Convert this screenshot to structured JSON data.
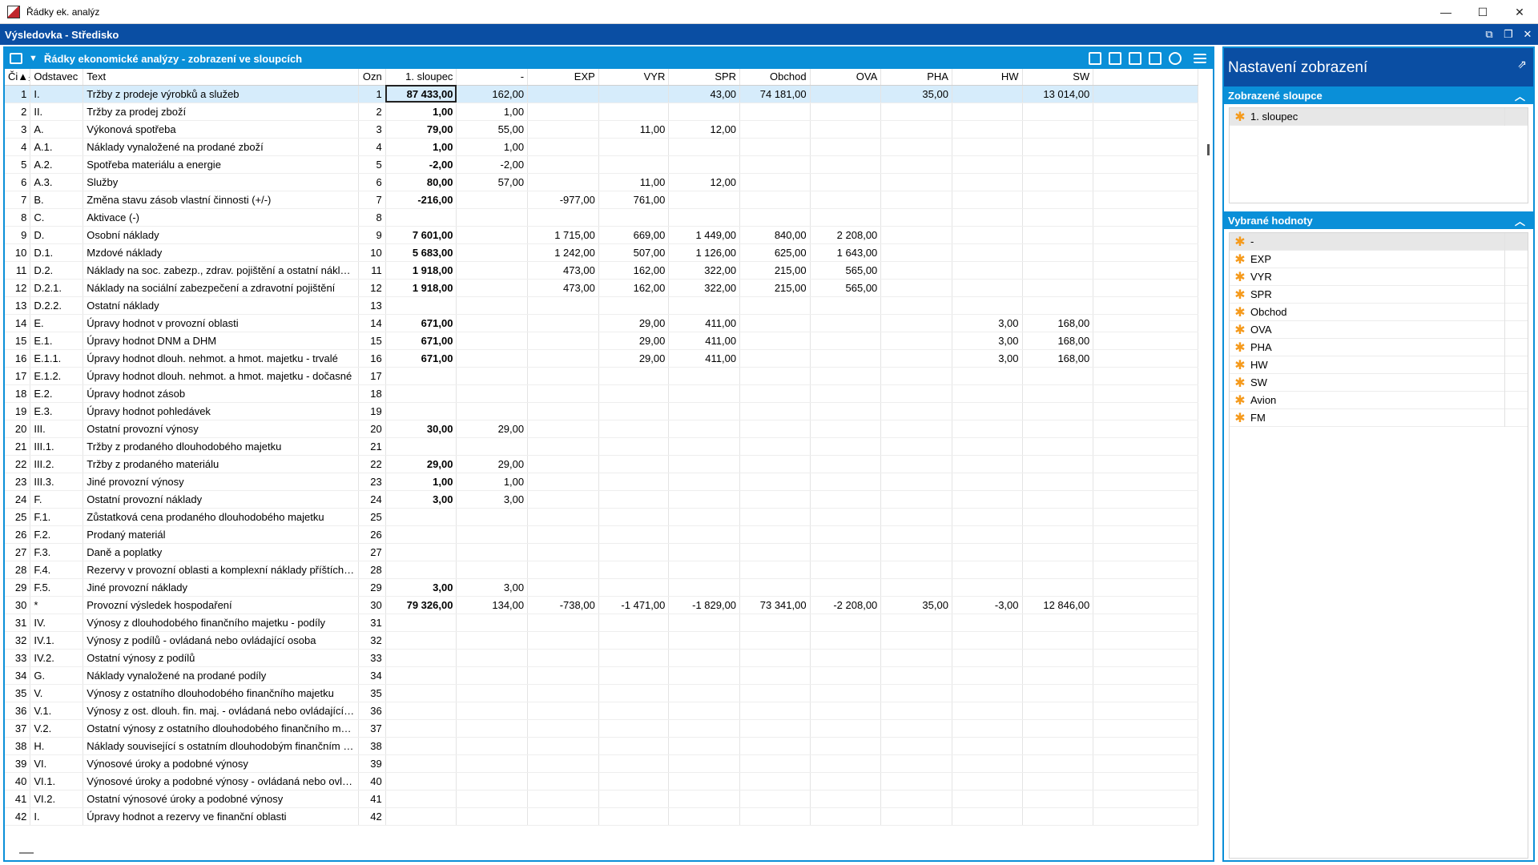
{
  "window": {
    "title": "Řádky ek. analýz",
    "min": "—",
    "max": "☐",
    "close": "✕"
  },
  "doc": {
    "title": "Výsledovka - Středisko",
    "restore": "⧉",
    "max": "❐",
    "close": "✕"
  },
  "panel": {
    "title": "Řádky ekonomické analýzy - zobrazení ve sloupcích"
  },
  "columns": [
    "Či▲₁",
    "Odstavec",
    "Text",
    "Ozn",
    "1. sloupec",
    "-",
    "EXP",
    "VYR",
    "SPR",
    "Obchod",
    "OVA",
    "PHA",
    "HW",
    "SW"
  ],
  "rows": [
    [
      "1",
      "I.",
      "Tržby z prodeje výrobků a služeb",
      "1",
      "87 433,00",
      "162,00",
      "",
      "",
      "43,00",
      "74 181,00",
      "",
      "35,00",
      "",
      "13 014,00"
    ],
    [
      "2",
      "II.",
      "Tržby za prodej zboží",
      "2",
      "1,00",
      "1,00",
      "",
      "",
      "",
      "",
      "",
      "",
      "",
      ""
    ],
    [
      "3",
      "A.",
      "Výkonová spotřeba",
      "3",
      "79,00",
      "55,00",
      "",
      "11,00",
      "12,00",
      "",
      "",
      "",
      "",
      ""
    ],
    [
      "4",
      "A.1.",
      "Náklady vynaložené na prodané zboží",
      "4",
      "1,00",
      "1,00",
      "",
      "",
      "",
      "",
      "",
      "",
      "",
      ""
    ],
    [
      "5",
      "A.2.",
      "Spotřeba materiálu a energie",
      "5",
      "-2,00",
      "-2,00",
      "",
      "",
      "",
      "",
      "",
      "",
      "",
      ""
    ],
    [
      "6",
      "A.3.",
      "Služby",
      "6",
      "80,00",
      "57,00",
      "",
      "11,00",
      "12,00",
      "",
      "",
      "",
      "",
      ""
    ],
    [
      "7",
      "B.",
      "Změna stavu zásob vlastní činnosti (+/-)",
      "7",
      "-216,00",
      "",
      "-977,00",
      "761,00",
      "",
      "",
      "",
      "",
      "",
      ""
    ],
    [
      "8",
      "C.",
      "Aktivace (-)",
      "8",
      "",
      "",
      "",
      "",
      "",
      "",
      "",
      "",
      "",
      ""
    ],
    [
      "9",
      "D.",
      "Osobní náklady",
      "9",
      "7 601,00",
      "",
      "1 715,00",
      "669,00",
      "1 449,00",
      "840,00",
      "2 208,00",
      "",
      "",
      ""
    ],
    [
      "10",
      "D.1.",
      "Mzdové náklady",
      "10",
      "5 683,00",
      "",
      "1 242,00",
      "507,00",
      "1 126,00",
      "625,00",
      "1 643,00",
      "",
      "",
      ""
    ],
    [
      "11",
      "D.2.",
      "Náklady na soc. zabezp., zdrav. pojištění a ostatní náklady",
      "11",
      "1 918,00",
      "",
      "473,00",
      "162,00",
      "322,00",
      "215,00",
      "565,00",
      "",
      "",
      ""
    ],
    [
      "12",
      "D.2.1.",
      "Náklady na sociální zabezpečení a zdravotní pojištění",
      "12",
      "1 918,00",
      "",
      "473,00",
      "162,00",
      "322,00",
      "215,00",
      "565,00",
      "",
      "",
      ""
    ],
    [
      "13",
      "D.2.2.",
      "Ostatní náklady",
      "13",
      "",
      "",
      "",
      "",
      "",
      "",
      "",
      "",
      "",
      ""
    ],
    [
      "14",
      "E.",
      "Úpravy hodnot v provozní oblasti",
      "14",
      "671,00",
      "",
      "",
      "29,00",
      "411,00",
      "",
      "",
      "",
      "3,00",
      "168,00"
    ],
    [
      "15",
      "E.1.",
      "Úpravy hodnot DNM a DHM",
      "15",
      "671,00",
      "",
      "",
      "29,00",
      "411,00",
      "",
      "",
      "",
      "3,00",
      "168,00"
    ],
    [
      "16",
      "E.1.1.",
      "Úpravy hodnot dlouh. nehmot. a hmot. majetku - trvalé",
      "16",
      "671,00",
      "",
      "",
      "29,00",
      "411,00",
      "",
      "",
      "",
      "3,00",
      "168,00"
    ],
    [
      "17",
      "E.1.2.",
      "Úpravy hodnot dlouh. nehmot. a hmot. majetku - dočasné",
      "17",
      "",
      "",
      "",
      "",
      "",
      "",
      "",
      "",
      "",
      ""
    ],
    [
      "18",
      "E.2.",
      "Úpravy hodnot zásob",
      "18",
      "",
      "",
      "",
      "",
      "",
      "",
      "",
      "",
      "",
      ""
    ],
    [
      "19",
      "E.3.",
      "Úpravy hodnot pohledávek",
      "19",
      "",
      "",
      "",
      "",
      "",
      "",
      "",
      "",
      "",
      ""
    ],
    [
      "20",
      "III.",
      "Ostatní provozní výnosy",
      "20",
      "30,00",
      "29,00",
      "",
      "",
      "",
      "",
      "",
      "",
      "",
      ""
    ],
    [
      "21",
      "III.1.",
      "Tržby z prodaného dlouhodobého majetku",
      "21",
      "",
      "",
      "",
      "",
      "",
      "",
      "",
      "",
      "",
      ""
    ],
    [
      "22",
      "III.2.",
      "Tržby z prodaného materiálu",
      "22",
      "29,00",
      "29,00",
      "",
      "",
      "",
      "",
      "",
      "",
      "",
      ""
    ],
    [
      "23",
      "III.3.",
      "Jiné provozní výnosy",
      "23",
      "1,00",
      "1,00",
      "",
      "",
      "",
      "",
      "",
      "",
      "",
      ""
    ],
    [
      "24",
      "F.",
      "Ostatní provozní náklady",
      "24",
      "3,00",
      "3,00",
      "",
      "",
      "",
      "",
      "",
      "",
      "",
      ""
    ],
    [
      "25",
      "F.1.",
      "Zůstatková cena prodaného dlouhodobého majetku",
      "25",
      "",
      "",
      "",
      "",
      "",
      "",
      "",
      "",
      "",
      ""
    ],
    [
      "26",
      "F.2.",
      "Prodaný materiál",
      "26",
      "",
      "",
      "",
      "",
      "",
      "",
      "",
      "",
      "",
      ""
    ],
    [
      "27",
      "F.3.",
      "Daně a poplatky",
      "27",
      "",
      "",
      "",
      "",
      "",
      "",
      "",
      "",
      "",
      ""
    ],
    [
      "28",
      "F.4.",
      "Rezervy v provozní oblasti a komplexní náklady příštích obd.",
      "28",
      "",
      "",
      "",
      "",
      "",
      "",
      "",
      "",
      "",
      ""
    ],
    [
      "29",
      "F.5.",
      "Jiné provozní náklady",
      "29",
      "3,00",
      "3,00",
      "",
      "",
      "",
      "",
      "",
      "",
      "",
      ""
    ],
    [
      "30",
      "*",
      "Provozní výsledek hospodaření",
      "30",
      "79 326,00",
      "134,00",
      "-738,00",
      "-1 471,00",
      "-1 829,00",
      "73 341,00",
      "-2 208,00",
      "35,00",
      "-3,00",
      "12 846,00"
    ],
    [
      "31",
      "IV.",
      "Výnosy z dlouhodobého finančního majetku - podíly",
      "31",
      "",
      "",
      "",
      "",
      "",
      "",
      "",
      "",
      "",
      ""
    ],
    [
      "32",
      "IV.1.",
      "Výnosy z podílů - ovládaná nebo ovládající osoba",
      "32",
      "",
      "",
      "",
      "",
      "",
      "",
      "",
      "",
      "",
      ""
    ],
    [
      "33",
      "IV.2.",
      "Ostatní výnosy z podílů",
      "33",
      "",
      "",
      "",
      "",
      "",
      "",
      "",
      "",
      "",
      ""
    ],
    [
      "34",
      "G.",
      "Náklady vynaložené na prodané podíly",
      "34",
      "",
      "",
      "",
      "",
      "",
      "",
      "",
      "",
      "",
      ""
    ],
    [
      "35",
      "V.",
      "Výnosy z ostatního dlouhodobého finančního majetku",
      "35",
      "",
      "",
      "",
      "",
      "",
      "",
      "",
      "",
      "",
      ""
    ],
    [
      "36",
      "V.1.",
      "Výnosy z ost. dlouh. fin. maj. - ovládaná nebo ovládající os.",
      "36",
      "",
      "",
      "",
      "",
      "",
      "",
      "",
      "",
      "",
      ""
    ],
    [
      "37",
      "V.2.",
      "Ostatní výnosy z ostatního dlouhodobého finančního majetku",
      "37",
      "",
      "",
      "",
      "",
      "",
      "",
      "",
      "",
      "",
      ""
    ],
    [
      "38",
      "H.",
      "Náklady související s ostatním dlouhodobým finančním maje...",
      "38",
      "",
      "",
      "",
      "",
      "",
      "",
      "",
      "",
      "",
      ""
    ],
    [
      "39",
      "VI.",
      "Výnosové úroky a podobné výnosy",
      "39",
      "",
      "",
      "",
      "",
      "",
      "",
      "",
      "",
      "",
      ""
    ],
    [
      "40",
      "VI.1.",
      "Výnosové úroky a podobné výnosy - ovládaná nebo ovládaj...",
      "40",
      "",
      "",
      "",
      "",
      "",
      "",
      "",
      "",
      "",
      ""
    ],
    [
      "41",
      "VI.2.",
      "Ostatní výnosové úroky a podobné výnosy",
      "41",
      "",
      "",
      "",
      "",
      "",
      "",
      "",
      "",
      "",
      ""
    ],
    [
      "42",
      "I.",
      "Úpravy hodnot a rezervy ve finanční oblasti",
      "42",
      "",
      "",
      "",
      "",
      "",
      "",
      "",
      "",
      "",
      ""
    ]
  ],
  "settings": {
    "title": "Nastavení zobrazení",
    "shown_columns_title": "Zobrazené sloupce",
    "shown_columns": [
      "1. sloupec"
    ],
    "selected_values_title": "Vybrané hodnoty",
    "selected_values": [
      "-",
      "EXP",
      "VYR",
      "SPR",
      "Obchod",
      "OVA",
      "PHA",
      "HW",
      "SW",
      "Avion",
      "FM"
    ]
  },
  "colors": {
    "accent": "#0a8fd8",
    "header_dark": "#0a4ea3",
    "selection": "#d6ecfb",
    "star": "#f59a1c"
  }
}
